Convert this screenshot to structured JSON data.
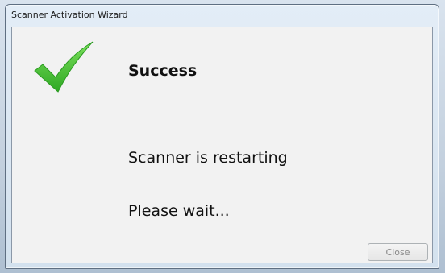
{
  "window": {
    "title": "Scanner Activation Wizard"
  },
  "content": {
    "icon": "checkmark-icon",
    "icon_color": "#3fbf2f",
    "heading": "Success",
    "line1": "Scanner is restarting",
    "line2": "Please wait..."
  },
  "buttons": {
    "close_label": "Close",
    "close_enabled": false
  }
}
